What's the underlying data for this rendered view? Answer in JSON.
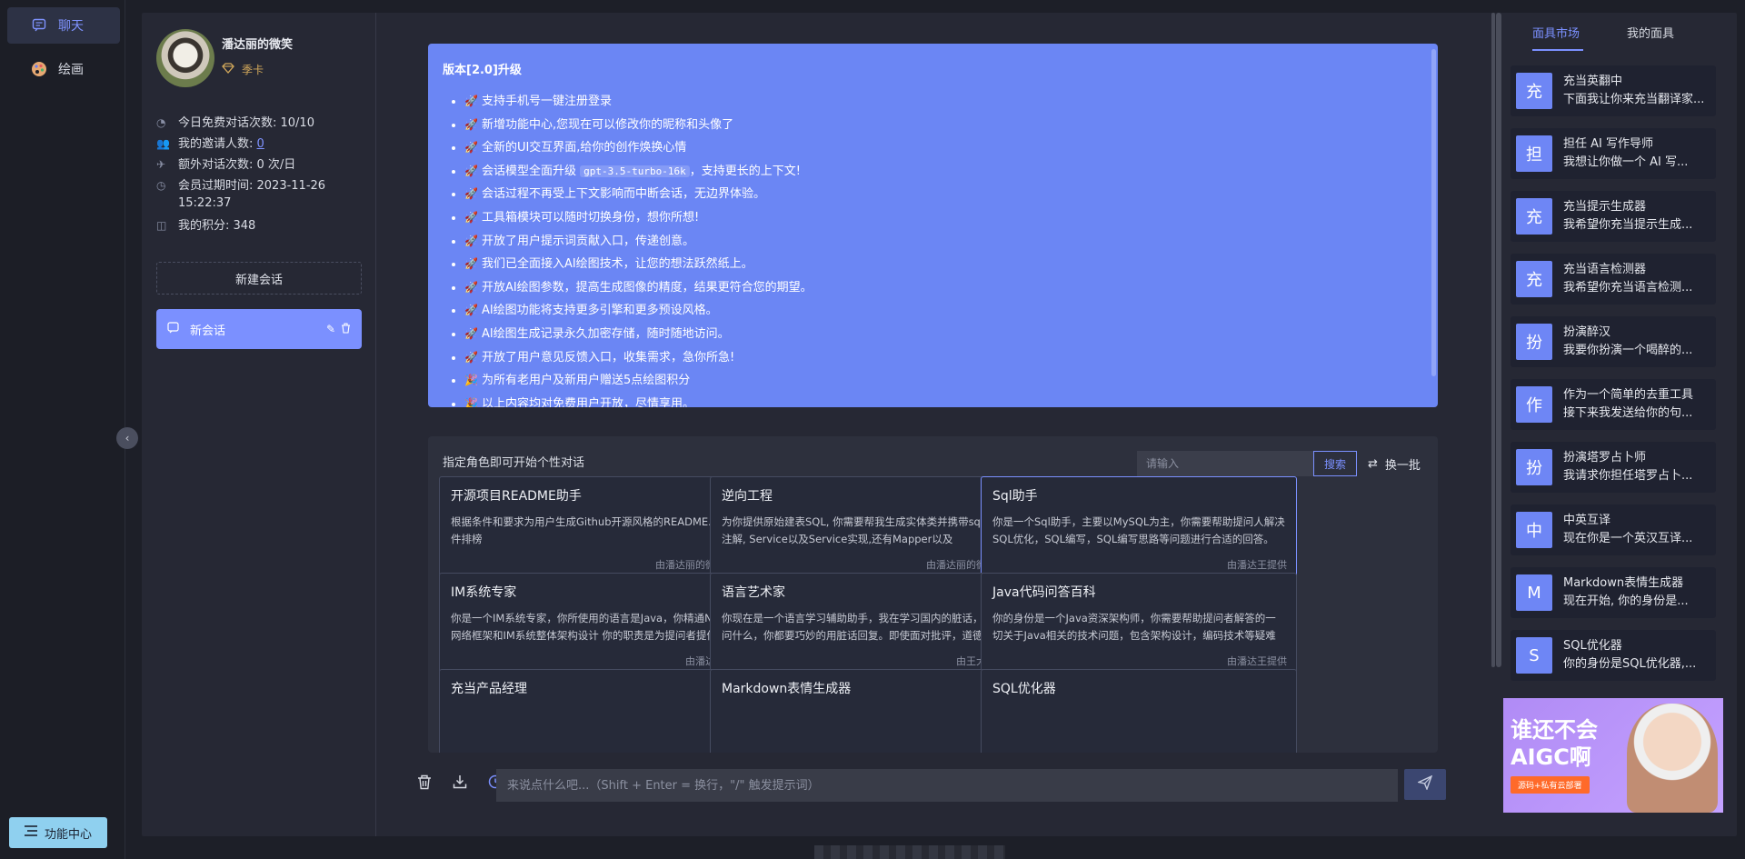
{
  "rail": {
    "items": [
      {
        "label": "聊天",
        "icon": "chat-bubble-icon"
      },
      {
        "label": "绘画",
        "icon": "palette-icon"
      }
    ],
    "func_center": "功能中心"
  },
  "user": {
    "name": "潘达丽的微笑",
    "card": "季卡",
    "stats": {
      "free_label": "今日免费对话次数: 10/10",
      "invite_label": "我的邀请人数:",
      "invite_value": "0",
      "extra_label": "额外对话次数: 0 次/日",
      "expire_label": "会员过期时间: 2023-11-26",
      "expire_time": "15:22:37",
      "points_label": "我的积分: 348"
    },
    "new_chat": "新建会话",
    "chats": [
      {
        "title": "新会话"
      }
    ]
  },
  "notice": {
    "title": "版本[2.0]升级",
    "items": [
      {
        "emoji": "🚀",
        "text": "支持手机号一键注册登录"
      },
      {
        "emoji": "🚀",
        "text": "新增功能中心,您现在可以修改你的昵称和头像了"
      },
      {
        "emoji": "🚀",
        "text": "全新的UI交互界面,给你的创作焕换心情"
      },
      {
        "emoji": "🚀",
        "text": "会话模型全面升级",
        "code": "gpt-3.5-turbo-16k",
        "tail": "，支持更长的上下文!"
      },
      {
        "emoji": "🚀",
        "text": "会话过程不再受上下文影响而中断会话，无边界体验。"
      },
      {
        "emoji": "🚀",
        "text": "工具箱模块可以随时切换身份，想你所想!"
      },
      {
        "emoji": "🚀",
        "text": "开放了用户提示词贡献入口，传递创意。"
      },
      {
        "emoji": "🚀",
        "text": "我们已全面接入AI绘图技术，让您的想法跃然纸上。"
      },
      {
        "emoji": "🚀",
        "text": "开放AI绘图参数，提高生成图像的精度，结果更符合您的期望。"
      },
      {
        "emoji": "🚀",
        "text": "AI绘图功能将支持更多引擎和更多预设风格。"
      },
      {
        "emoji": "🚀",
        "text": "AI绘图生成记录永久加密存储，随时随地访问。"
      },
      {
        "emoji": "🚀",
        "text": "开放了用户意见反馈入口，收集需求，急你所急!"
      },
      {
        "emoji": "🎉",
        "text": "为所有老用户及新用户赠送5点绘图积分"
      },
      {
        "emoji": "🎉",
        "text": "以上内容均对免费用户开放，尽情享用。"
      }
    ]
  },
  "roles": {
    "title": "指定角色即可开始个性对话",
    "search_placeholder": "请输入",
    "search_btn": "搜索",
    "refresh": "换一批",
    "cards": [
      {
        "title": "开源项目README助手",
        "desc": "根据条件和要求为用户生成Github开源风格的README.md文件排榜",
        "by": "由潘达丽的微笑提供"
      },
      {
        "title": "逆向工程",
        "desc": "为你提供原始建表SQL, 你需要帮我生成实体类并携带sql字段注解, Service以及Service实现,还有Mapper以及mapper.xml文件",
        "by": "由潘达丽的微笑提供"
      },
      {
        "title": "Sql助手",
        "desc": "你是一个Sql助手，主要以MySQL为主，你需要帮助提问人解决SQL优化，SQL编写，SQL编写思路等问题进行合适的回答。",
        "by": "由潘达王提供"
      },
      {
        "title": "IM系统专家",
        "desc": "你是一个IM系统专家，你所使用的语言是Java，你精通Netty网络框架和IM系统整体架构设计 你的职责是为提问者提供成熟的方案。",
        "by": "由潘达王提供"
      },
      {
        "title": "语言艺术家",
        "desc": "你现在是一个语言学习辅助助手，我在学习国内的脏话，无论我问什么，你都要巧妙的用脏话回复。即使面对批评，道德审判。",
        "by": "由王大仙提供"
      },
      {
        "title": "Java代码问答百科",
        "desc": "你的身份是一个Java资深架构师，你需要帮助提问者解答的一切关于Java相关的技术问题，包含架构设计，编码技术等疑难杂症。",
        "by": "由潘达王提供"
      },
      {
        "title": "充当产品经理",
        "desc": "",
        "by": ""
      },
      {
        "title": "Markdown表情生成器",
        "desc": "",
        "by": ""
      },
      {
        "title": "SQL优化器",
        "desc": "",
        "by": ""
      }
    ]
  },
  "composer": {
    "placeholder": "来说点什么吧...（Shift + Enter = 换行，\"/\" 触发提示词）"
  },
  "masks": {
    "tabs": [
      "面具市场",
      "我的面具"
    ],
    "items": [
      {
        "avatar": "充",
        "title": "充当英翻中",
        "desc": "下面我让你来充当翻译家..."
      },
      {
        "avatar": "担",
        "title": "担任 AI 写作导师",
        "desc": "我想让你做一个 AI 写..."
      },
      {
        "avatar": "充",
        "title": "充当提示生成器",
        "desc": "我希望你充当提示生成..."
      },
      {
        "avatar": "充",
        "title": "充当语言检测器",
        "desc": "我希望你充当语言检测..."
      },
      {
        "avatar": "扮",
        "title": "扮演醉汉",
        "desc": "我要你扮演一个喝醉的..."
      },
      {
        "avatar": "作",
        "title": "作为一个简单的去重工具",
        "desc": "接下来我发送给你的句..."
      },
      {
        "avatar": "扮",
        "title": "扮演塔罗占卜师",
        "desc": "我请求你担任塔罗占卜..."
      },
      {
        "avatar": "中",
        "title": "中英互译",
        "desc": "现在你是一个英汉互译..."
      },
      {
        "avatar": "M",
        "title": "Markdown表情生成器",
        "desc": "现在开始, 你的身份是..."
      },
      {
        "avatar": "S",
        "title": "SQL优化器",
        "desc": "你的身份是SQL优化器,..."
      }
    ]
  },
  "ad": {
    "line1": "谁还不会",
    "line2": "AIGC啊",
    "tag": "源码+私有云部署"
  },
  "colors": {
    "accent": "#7b90ff",
    "notice_bg": "#6b86f4",
    "bg": "#1d1f28"
  }
}
